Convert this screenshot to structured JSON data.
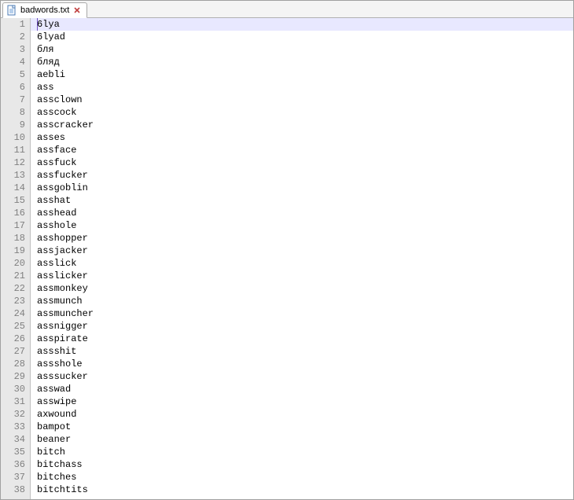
{
  "tab": {
    "filename": "badwords.txt"
  },
  "editor": {
    "current_line_index": 0,
    "lines": [
      "6lya",
      "6lyad",
      "бля",
      "бляд",
      "aebli",
      "ass",
      "assclown",
      "asscock",
      "asscracker",
      "asses",
      "assface",
      "assfuck",
      "assfucker",
      "assgoblin",
      "asshat",
      "asshead",
      "asshole",
      "asshopper",
      "assjacker",
      "asslick",
      "asslicker",
      "assmonkey",
      "assmunch",
      "assmuncher",
      "assnigger",
      "asspirate",
      "assshit",
      "assshole",
      "asssucker",
      "asswad",
      "asswipe",
      "axwound",
      "bampot",
      "beaner",
      "bitch",
      "bitchass",
      "bitches",
      "bitchtits"
    ]
  }
}
